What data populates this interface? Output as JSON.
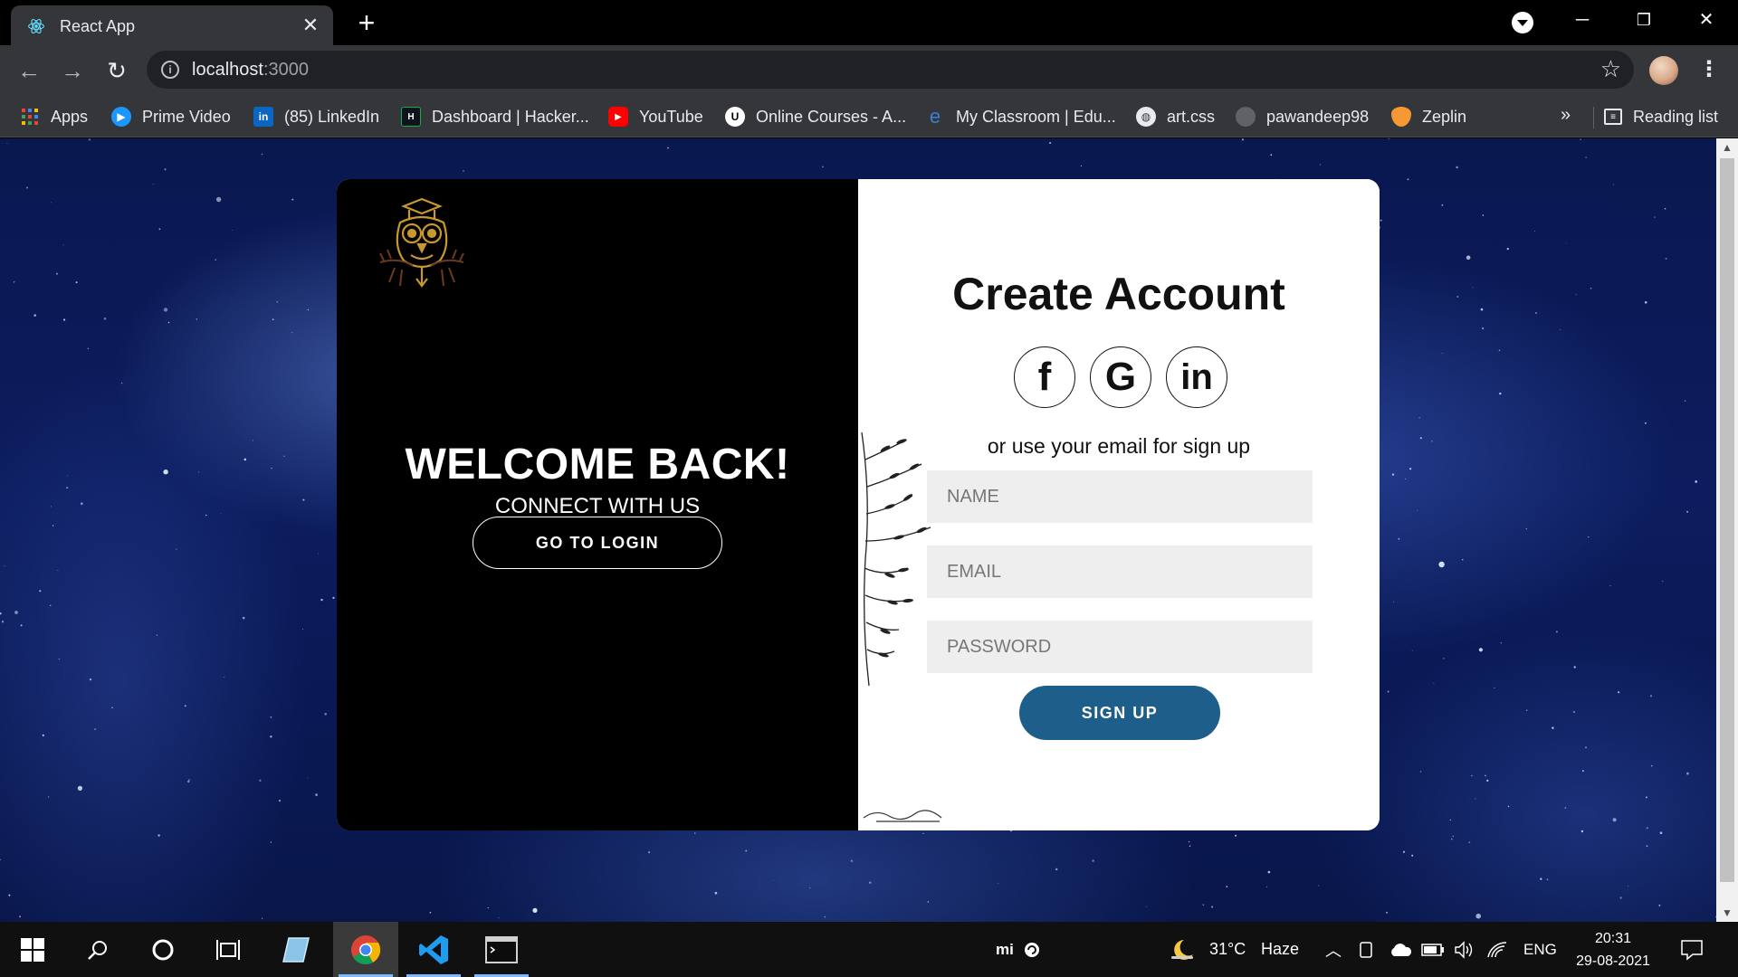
{
  "browser": {
    "tab_title": "React App",
    "new_tab_symbol": "+",
    "url_host": "localhost",
    "url_port": ":3000",
    "bookmarks": [
      {
        "label": "Apps",
        "icon": "apps-grid-icon",
        "color": "#4285f4"
      },
      {
        "label": "Prime Video",
        "icon": "prime-video-icon",
        "color": "#1a98ff"
      },
      {
        "label": "(85) LinkedIn",
        "icon": "linkedin-icon",
        "color": "#0a66c2"
      },
      {
        "label": "Dashboard | Hacker...",
        "icon": "hackerrank-icon",
        "color": "#1ba94c"
      },
      {
        "label": "YouTube",
        "icon": "youtube-icon",
        "color": "#ff0000"
      },
      {
        "label": "Online Courses - A...",
        "icon": "udemy-icon",
        "color": "#ffffff"
      },
      {
        "label": "My Classroom | Edu...",
        "icon": "edureka-icon",
        "color": "#3b7dd8"
      },
      {
        "label": "art.css",
        "icon": "globe-icon",
        "color": "#e8eaed"
      },
      {
        "label": "pawandeep98",
        "icon": "github-icon",
        "color": "#5f6368"
      },
      {
        "label": "Zeplin",
        "icon": "zeplin-icon",
        "color": "#f69833"
      }
    ],
    "more_bookmarks": "»",
    "reading_list": "Reading list"
  },
  "page": {
    "left": {
      "welcome": "WELCOME BACK!",
      "connect": "CONNECT WITH US",
      "login_button": "GO TO LOGIN"
    },
    "right": {
      "title": "Create Account",
      "socials": [
        {
          "label": "f",
          "icon": "facebook-icon"
        },
        {
          "label": "G",
          "icon": "google-icon"
        },
        {
          "label": "in",
          "icon": "linkedin-icon"
        }
      ],
      "or_text": "or use your email for sign up",
      "fields": {
        "name_placeholder": "NAME",
        "email_placeholder": "EMAIL",
        "password_placeholder": "PASSWORD"
      },
      "signup_button": "SIGN UP"
    },
    "colors": {
      "signup_button": "#1d5f8a",
      "left_panel": "#000000",
      "field_bg": "#eeeeee"
    }
  },
  "taskbar": {
    "weather_temp": "31°C",
    "weather_desc": "Haze",
    "language": "ENG",
    "time": "20:31",
    "date": "29-08-2021",
    "mi_label": "mi"
  }
}
